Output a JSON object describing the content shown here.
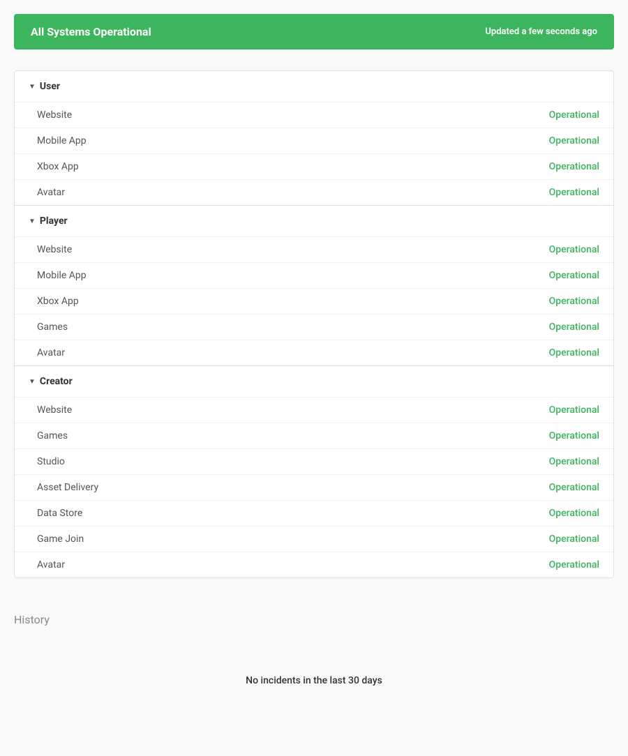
{
  "banner": {
    "title": "All Systems Operational",
    "updated": "Updated a few seconds ago"
  },
  "groups": [
    {
      "id": "user",
      "label": "User",
      "services": [
        {
          "name": "Website",
          "status": "Operational"
        },
        {
          "name": "Mobile App",
          "status": "Operational"
        },
        {
          "name": "Xbox App",
          "status": "Operational"
        },
        {
          "name": "Avatar",
          "status": "Operational"
        }
      ]
    },
    {
      "id": "player",
      "label": "Player",
      "services": [
        {
          "name": "Website",
          "status": "Operational"
        },
        {
          "name": "Mobile App",
          "status": "Operational"
        },
        {
          "name": "Xbox App",
          "status": "Operational"
        },
        {
          "name": "Games",
          "status": "Operational"
        },
        {
          "name": "Avatar",
          "status": "Operational"
        }
      ]
    },
    {
      "id": "creator",
      "label": "Creator",
      "services": [
        {
          "name": "Website",
          "status": "Operational"
        },
        {
          "name": "Games",
          "status": "Operational"
        },
        {
          "name": "Studio",
          "status": "Operational"
        },
        {
          "name": "Asset Delivery",
          "status": "Operational"
        },
        {
          "name": "Data Store",
          "status": "Operational"
        },
        {
          "name": "Game Join",
          "status": "Operational"
        },
        {
          "name": "Avatar",
          "status": "Operational"
        }
      ]
    }
  ],
  "history": {
    "title": "History",
    "no_incidents": "No incidents in the last 30 days"
  }
}
